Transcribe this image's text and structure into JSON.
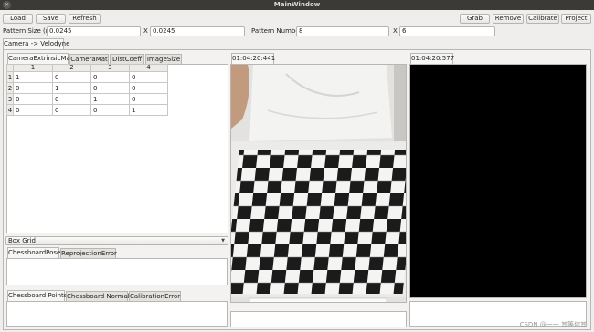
{
  "window": {
    "title": "MainWindow",
    "close_glyph": "✕"
  },
  "toolbar": {
    "load": "Load",
    "save": "Save",
    "refresh": "Refresh",
    "grab": "Grab",
    "remove": "Remove",
    "calibrate": "Calibrate",
    "project": "Project"
  },
  "params": {
    "pattern_size_label": "Pattern Size (m)",
    "pattern_size_x": "0.0245",
    "x_label_1": "X",
    "pattern_size_y": "0.0245",
    "pattern_number_label": "Pattern Number",
    "pattern_number_x": "8",
    "x_label_2": "X",
    "pattern_number_y": "6"
  },
  "main_tab": "Camera -> Velodyne",
  "left_tabs": [
    "CameraExtrinsicMat",
    "CameraMat",
    "DistCoeff",
    "ImageSize"
  ],
  "matrix": {
    "columns": [
      "1",
      "2",
      "3",
      "4"
    ],
    "rows": [
      {
        "header": "1",
        "cells": [
          "1",
          "0",
          "0",
          "0"
        ]
      },
      {
        "header": "2",
        "cells": [
          "0",
          "1",
          "0",
          "0"
        ]
      },
      {
        "header": "3",
        "cells": [
          "0",
          "0",
          "1",
          "0"
        ]
      },
      {
        "header": "4",
        "cells": [
          "0",
          "0",
          "0",
          "1"
        ]
      }
    ]
  },
  "box_grid": {
    "selected": "Box Grid",
    "arrow": "▼"
  },
  "mid_tabs": [
    "ChessboardPose",
    "ReprojectionError"
  ],
  "bottom_tabs": [
    "Chessboard Points",
    "Chessboard Normals",
    "CalibrationError"
  ],
  "camera_view": {
    "timestamp": "01:04:20:441"
  },
  "lidar_view": {
    "timestamp": "01:04:20:577"
  },
  "watermark": "CSDN @一一 其等何其"
}
